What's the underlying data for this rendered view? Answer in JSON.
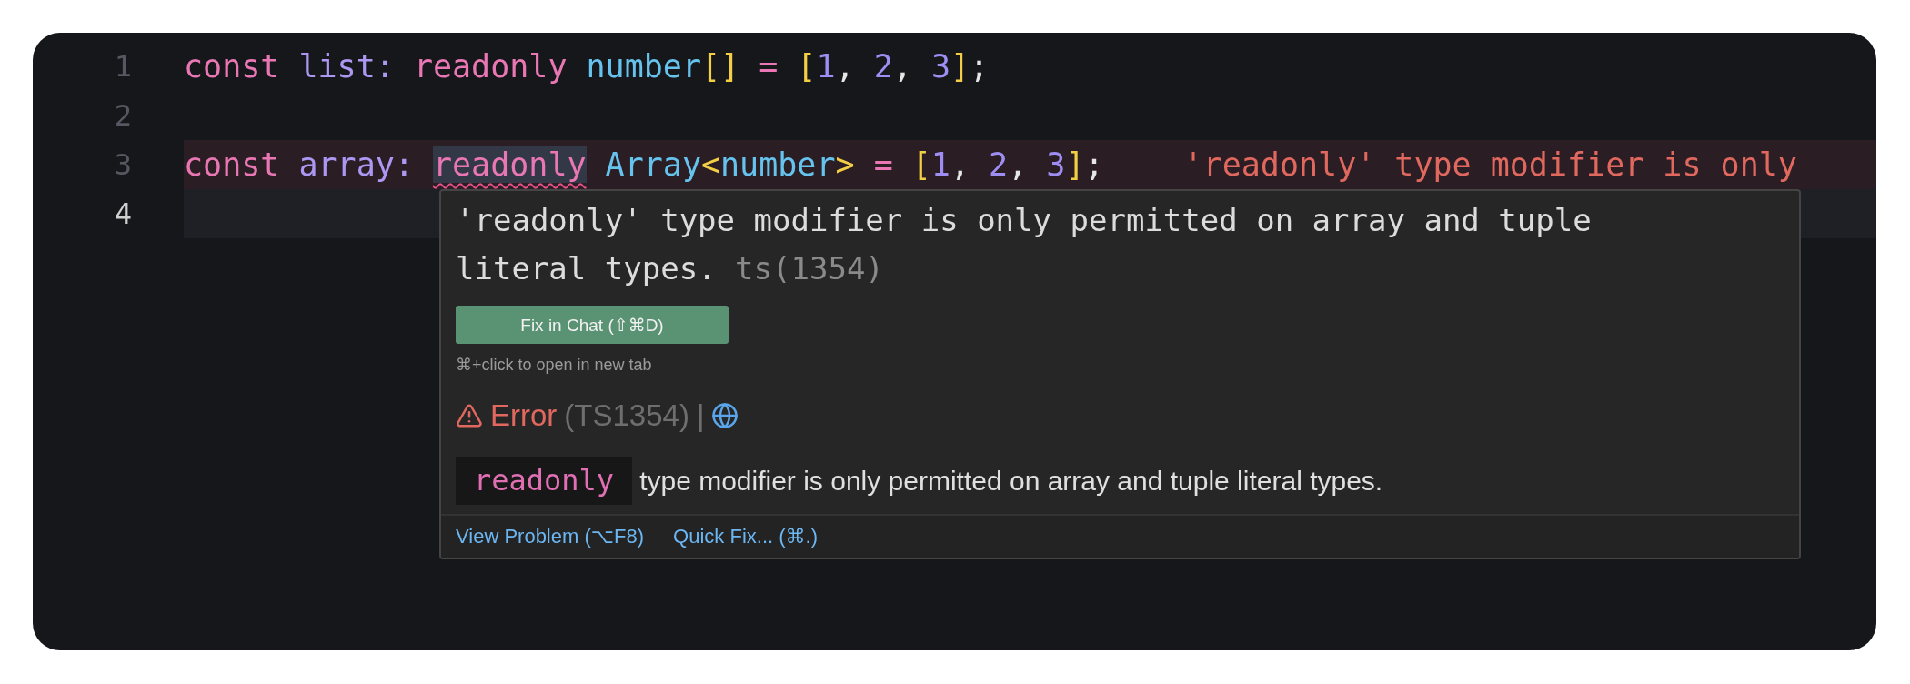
{
  "editor": {
    "lines": [
      {
        "number": "1",
        "current": false,
        "error": false,
        "tokens": [
          {
            "text": "const ",
            "kind": "keyword"
          },
          {
            "text": "list",
            "kind": "variable"
          },
          {
            "text": ": ",
            "kind": "variable"
          },
          {
            "text": "readonly ",
            "kind": "keyword"
          },
          {
            "text": "number",
            "kind": "type"
          },
          {
            "text": "[]",
            "kind": "bracket"
          },
          {
            "text": " = ",
            "kind": "operator"
          },
          {
            "text": "[",
            "kind": "bracket"
          },
          {
            "text": "1",
            "kind": "number"
          },
          {
            "text": ", ",
            "kind": "punct"
          },
          {
            "text": "2",
            "kind": "number"
          },
          {
            "text": ", ",
            "kind": "punct"
          },
          {
            "text": "3",
            "kind": "number"
          },
          {
            "text": "]",
            "kind": "bracket"
          },
          {
            "text": ";",
            "kind": "punct"
          }
        ]
      },
      {
        "number": "2",
        "current": false,
        "error": false
      },
      {
        "number": "3",
        "current": false,
        "error": true,
        "diagnostic": "'readonly' type modifier is only",
        "tokens": [
          {
            "text": "const ",
            "kind": "keyword"
          },
          {
            "text": "array",
            "kind": "variable"
          },
          {
            "text": ": ",
            "kind": "variable"
          },
          {
            "text": "readonly",
            "kind": "flagged"
          },
          {
            "text": " Array",
            "kind": "type"
          },
          {
            "text": "<",
            "kind": "bracket"
          },
          {
            "text": "number",
            "kind": "type"
          },
          {
            "text": ">",
            "kind": "bracket"
          },
          {
            "text": " = ",
            "kind": "operator"
          },
          {
            "text": "[",
            "kind": "bracket"
          },
          {
            "text": "1",
            "kind": "number"
          },
          {
            "text": ", ",
            "kind": "punct"
          },
          {
            "text": "2",
            "kind": "number"
          },
          {
            "text": ", ",
            "kind": "punct"
          },
          {
            "text": "3",
            "kind": "number"
          },
          {
            "text": "]",
            "kind": "bracket"
          },
          {
            "text": ";",
            "kind": "punct"
          }
        ]
      },
      {
        "number": "4",
        "current": true,
        "error": false
      }
    ]
  },
  "hover": {
    "message": "'readonly' type modifier is only permitted on array and tuple literal types.",
    "source": "ts(1354)",
    "fix_button": "Fix in Chat (⇧⌘D)",
    "hint": "⌘+click to open in new tab",
    "severity": "Error",
    "code": "(TS1354)",
    "separator": "|",
    "chip": "readonly",
    "description": "type modifier is only permitted on array and tuple literal types.",
    "actions": [
      "View Problem (⌥F8)",
      "Quick Fix... (⌘.)"
    ]
  }
}
